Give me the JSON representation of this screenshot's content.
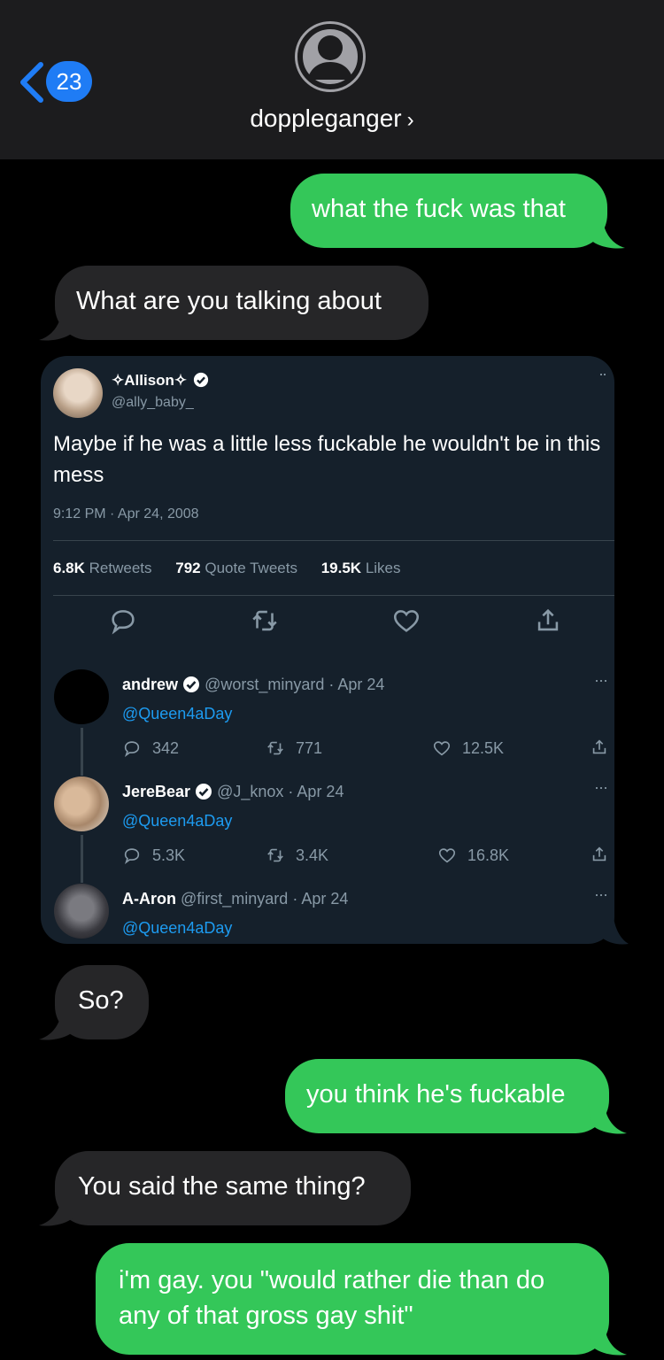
{
  "header": {
    "back_count": "23",
    "contact_name": "dopplеganger",
    "contact_chevron": "›"
  },
  "messages": [
    {
      "direction": "outgoing",
      "text": "what the fuck was that"
    },
    {
      "direction": "incoming",
      "text": "What are you talking about"
    },
    {
      "direction": "incoming",
      "type": "tweet-screenshot"
    },
    {
      "direction": "incoming",
      "text": "So?"
    },
    {
      "direction": "outgoing",
      "text": "you think he's fuckable"
    },
    {
      "direction": "incoming",
      "text": "You said the same thing?"
    },
    {
      "direction": "outgoing",
      "text": "i'm gay. you \"would rather die than do any of that gross gay shit\""
    }
  ],
  "tweet": {
    "author_name": "✧Allison✧",
    "author_handle": "@ally_baby_",
    "text": "Maybe if he was a little less fuckable he wouldn't be in this mess",
    "timestamp": "9:12 PM · Apr 24, 2008",
    "retweets_count": "6.8K",
    "retweets_label": "Retweets",
    "quotes_count": "792",
    "quotes_label": "Quote Tweets",
    "likes_count": "19.5K",
    "likes_label": "Likes",
    "more": "··",
    "replies": [
      {
        "name": "andrew",
        "verified": true,
        "handle": "@worst_minyard",
        "date": "· Apr 24",
        "mention": "@Queen4aDay",
        "reply_count": "342",
        "retweet_count": "771",
        "like_count": "12.5K",
        "more": "···"
      },
      {
        "name": "JereBear",
        "verified": true,
        "handle": "@J_knox",
        "date": "· Apr 24",
        "mention": "@Queen4aDay",
        "reply_count": "5.3K",
        "retweet_count": "3.4K",
        "like_count": "16.8K",
        "more": "···"
      },
      {
        "name": "A-Aron",
        "verified": false,
        "handle": "@first_minyard",
        "date": "· Apr 24",
        "mention": "@Queen4aDay",
        "more": "···"
      }
    ]
  },
  "colors": {
    "outgoing_bubble": "#34c759",
    "incoming_bubble": "#262628",
    "header_bg": "#1c1c1e",
    "badge": "#1f7cf5",
    "tweet_bg": "#15202b",
    "verified": "#1d9bf0"
  },
  "icons": [
    "chevron-left-icon",
    "contact-avatar-icon",
    "reply-icon",
    "retweet-icon",
    "like-icon",
    "share-icon",
    "verified-icon"
  ]
}
